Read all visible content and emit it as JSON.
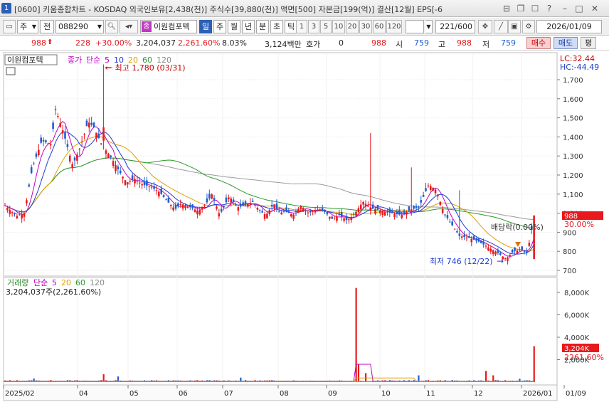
{
  "window": {
    "number": "1",
    "title": "[0600] 키움종합차트 - KOSDAQ 외국인보유[2,438(천)] 주식수[39,880(천)] 액면[500] 자본금[199(억)] 결산[12월] EPS[-6"
  },
  "toolbar": {
    "market": "주",
    "prev": "전",
    "code": "088290",
    "stock_name": "이원컴포텍",
    "stock_badge": "종",
    "periods": [
      "일",
      "주",
      "월",
      "년",
      "분",
      "초",
      "틱"
    ],
    "multipliers": [
      "1",
      "3",
      "5",
      "10",
      "20",
      "30",
      "60",
      "120"
    ],
    "count": "221",
    "count_max": "/600",
    "date": "2026/01/09"
  },
  "quote": {
    "price": "988",
    "change": "228",
    "change_pct": "+30.00%",
    "volume": "3,204,037",
    "volume_pct": "2,261.60%",
    "turnover": "8.03%",
    "amount": "3,124백만",
    "hoga_label": "호가",
    "hoga_value": "0",
    "price2": "988",
    "si_label": "시",
    "si_value": "759",
    "go_label": "고",
    "go_value": "988",
    "jeo_label": "저",
    "jeo_value": "759",
    "buy": "매수",
    "sell": "매도",
    "extra": "평"
  },
  "price_panel": {
    "name_box": "이원컴포텍",
    "legend": [
      {
        "text": "종가",
        "color": "#c000c0"
      },
      {
        "text": "단순",
        "color": "#c000c0"
      },
      {
        "text": "5",
        "color": "#c000c0"
      },
      {
        "text": "10",
        "color": "#1e3cd8"
      },
      {
        "text": "20",
        "color": "#e0a000"
      },
      {
        "text": "60",
        "color": "#2a9a2a"
      },
      {
        "text": "120",
        "color": "#888888"
      }
    ],
    "lc": "LC:32.44",
    "hc": "HC:-44.49",
    "high_note": "최고 1,780 (03/31)",
    "low_note": "최저 746 (12/22)",
    "dividend_note": "배당락(0.00%)",
    "current_tag": "988",
    "current_pct": "30.00%",
    "y_ticks": [
      "1,700",
      "1,600",
      "1,500",
      "1,400",
      "1,300",
      "1,200",
      "1,100",
      "1,000",
      "900",
      "800",
      "700"
    ]
  },
  "volume_panel": {
    "legend": [
      {
        "text": "거래량",
        "color": "#2a8a2a"
      },
      {
        "text": "단순",
        "color": "#c000c0"
      },
      {
        "text": "5",
        "color": "#c000c0"
      },
      {
        "text": "20",
        "color": "#e0a000"
      },
      {
        "text": "60",
        "color": "#2a9a2a"
      },
      {
        "text": "120",
        "color": "#888888"
      }
    ],
    "value_line": "3,204,037주(2,261.60%)",
    "y_ticks": [
      "8,000K",
      "6,000K",
      "4,000K",
      "2,000K"
    ],
    "current_tag": "3,204K",
    "current_pct": "2261.60%"
  },
  "x_axis": [
    "2025/02",
    "04",
    "05",
    "06",
    "07",
    "08",
    "09",
    "10",
    "11",
    "12",
    "2026/01",
    "01/09"
  ],
  "colors": {
    "up": "#e8191c",
    "down": "#1e5fd0"
  }
}
